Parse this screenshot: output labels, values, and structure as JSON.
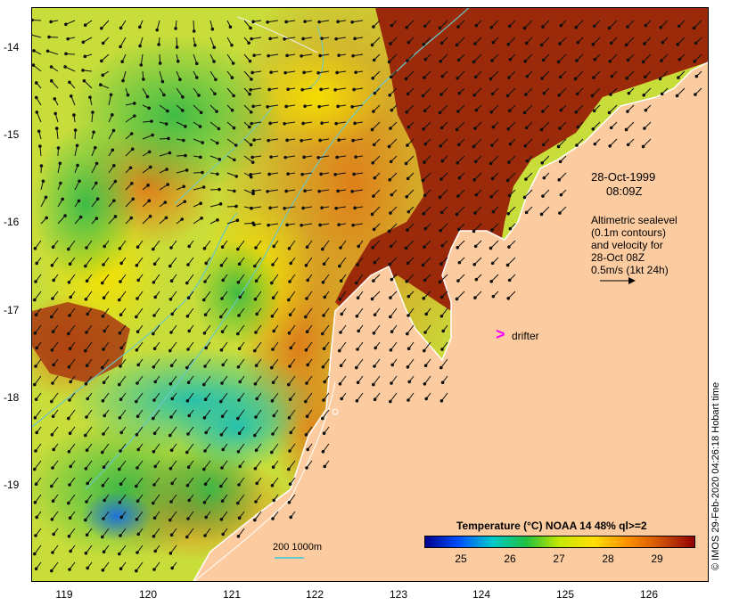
{
  "map": {
    "y_ticks": [
      "-14",
      "-15",
      "-16",
      "-17",
      "-18",
      "-19"
    ],
    "x_ticks": [
      "119",
      "120",
      "121",
      "122",
      "123",
      "124",
      "125",
      "126"
    ],
    "date": "28-Oct-1999",
    "time": "08:09Z",
    "altimetry_note": "Altimetric sealevel\n(0.1m contours)\nand velocity for\n28-Oct 08Z\n0.5m/s (1kt 24h)",
    "drifter_label": "drifter",
    "scale_label": "200  1000m",
    "credit": "© IMOS 29-Feb-2020 04:26:18 Hobart time",
    "land_color": "#fccca0",
    "drifter_color": "#ff00ff"
  },
  "colorbar": {
    "title": "Temperature (°C) NOAA 14 48% ql>=2",
    "ticks": [
      "25",
      "26",
      "27",
      "28",
      "29"
    ],
    "colors": [
      "#00008c",
      "#0050ff",
      "#00c8c8",
      "#20c040",
      "#c8e800",
      "#ffe000",
      "#ff9000",
      "#d05000",
      "#900000"
    ]
  }
}
